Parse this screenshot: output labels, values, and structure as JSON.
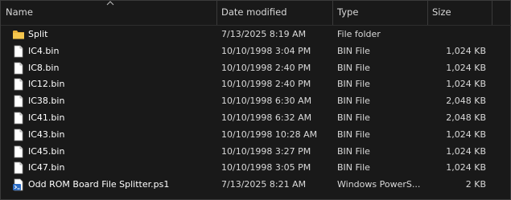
{
  "columns": {
    "name": "Name",
    "date": "Date modified",
    "type": "Type",
    "size": "Size"
  },
  "files": [
    {
      "name": "Split",
      "date": "7/13/2025 8:19 AM",
      "type": "File folder",
      "size": "",
      "icon": "folder-icon"
    },
    {
      "name": "IC4.bin",
      "date": "10/10/1998 3:04 PM",
      "type": "BIN File",
      "size": "1,024 KB",
      "icon": "file-icon"
    },
    {
      "name": "IC8.bin",
      "date": "10/10/1998 2:40 PM",
      "type": "BIN File",
      "size": "1,024 KB",
      "icon": "file-icon"
    },
    {
      "name": "IC12.bin",
      "date": "10/10/1998 2:40 PM",
      "type": "BIN File",
      "size": "1,024 KB",
      "icon": "file-icon"
    },
    {
      "name": "IC38.bin",
      "date": "10/10/1998 6:30 AM",
      "type": "BIN File",
      "size": "2,048 KB",
      "icon": "file-icon"
    },
    {
      "name": "IC41.bin",
      "date": "10/10/1998 6:32 AM",
      "type": "BIN File",
      "size": "2,048 KB",
      "icon": "file-icon"
    },
    {
      "name": "IC43.bin",
      "date": "10/10/1998 10:28 AM",
      "type": "BIN File",
      "size": "1,024 KB",
      "icon": "file-icon"
    },
    {
      "name": "IC45.bin",
      "date": "10/10/1998 3:27 PM",
      "type": "BIN File",
      "size": "1,024 KB",
      "icon": "file-icon"
    },
    {
      "name": "IC47.bin",
      "date": "10/10/1998 3:05 PM",
      "type": "BIN File",
      "size": "1,024 KB",
      "icon": "file-icon"
    },
    {
      "name": "Odd ROM Board File Splitter.ps1",
      "date": "7/13/2025 8:21 AM",
      "type": "Windows PowerS...",
      "size": "2 KB",
      "icon": "powershell-script-icon"
    }
  ],
  "colors": {
    "background": "#191919",
    "folder": "#f0c24a",
    "text": "#ffffff"
  }
}
